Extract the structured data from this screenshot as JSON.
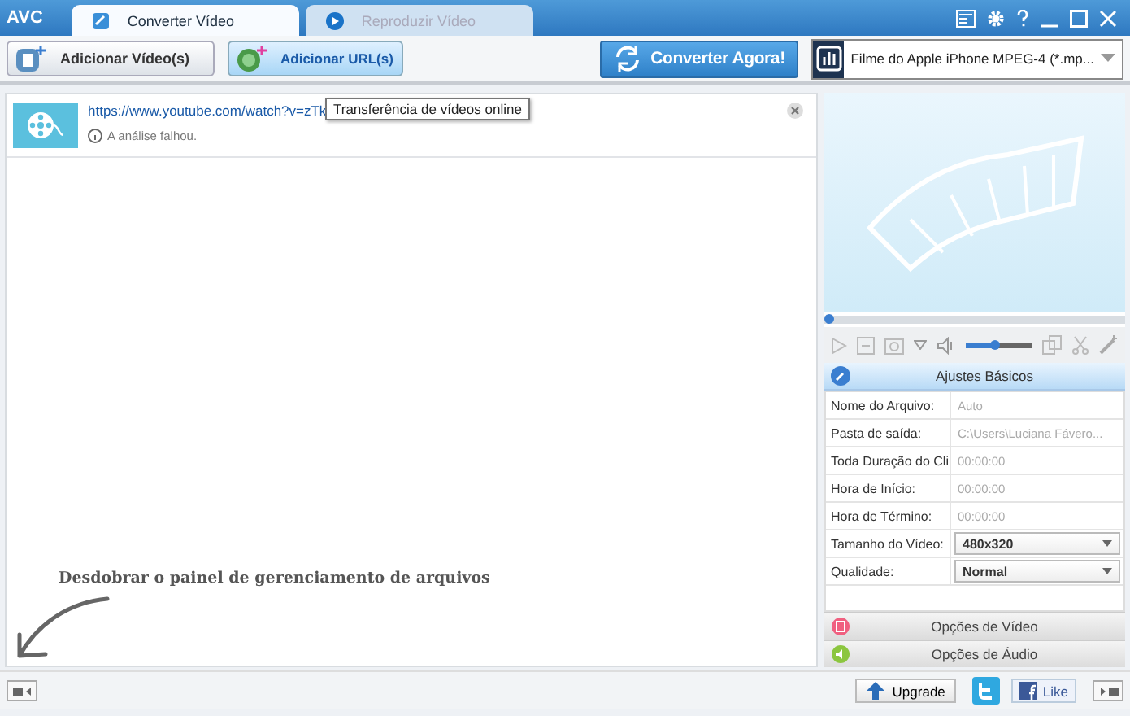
{
  "app": {
    "logo": "AVC"
  },
  "tabs": [
    {
      "label": "Converter Vídeo",
      "selected": true
    },
    {
      "label": "Reproduzir Vídeo",
      "selected": false
    }
  ],
  "toolbar": {
    "add_video": "Adicionar Vídeo(s)",
    "add_url": "Adicionar URL(s)",
    "convert": "Converter Agora!",
    "profile": "Filme do Apple iPhone MPEG-4 (*.mp..."
  },
  "tooltip": "Transferência de vídeos online",
  "files": [
    {
      "url": "https://www.youtube.com/watch?v=zTk",
      "status": "A análise falhou."
    }
  ],
  "hint": "Desdobrar o painel de gerenciamento de arquivos",
  "player": {
    "seek": {
      "level": 0.0
    },
    "volume": {
      "level": 0.45
    }
  },
  "settings": {
    "title": "Ajustes Básicos",
    "rows": [
      {
        "label": "Nome do Arquivo:",
        "value": "Auto",
        "kind": "text"
      },
      {
        "label": "Pasta de saída:",
        "value": "C:\\Users\\Luciana Fávero...",
        "kind": "text"
      },
      {
        "label": "Toda Duração do Cli",
        "value": "00:00:00",
        "kind": "text"
      },
      {
        "label": "Hora de Início:",
        "value": "00:00:00",
        "kind": "text"
      },
      {
        "label": "Hora de Término:",
        "value": "00:00:00",
        "kind": "text"
      },
      {
        "label": "Tamanho do Vídeo:",
        "value": "480x320",
        "kind": "select"
      },
      {
        "label": "Qualidade:",
        "value": "Normal",
        "kind": "select"
      }
    ]
  },
  "sections": [
    {
      "label": "Opções de Vídeo",
      "kind": "video"
    },
    {
      "label": "Opções de Áudio",
      "kind": "audio"
    }
  ],
  "footer": {
    "upgrade": "Upgrade",
    "like": "Like"
  }
}
